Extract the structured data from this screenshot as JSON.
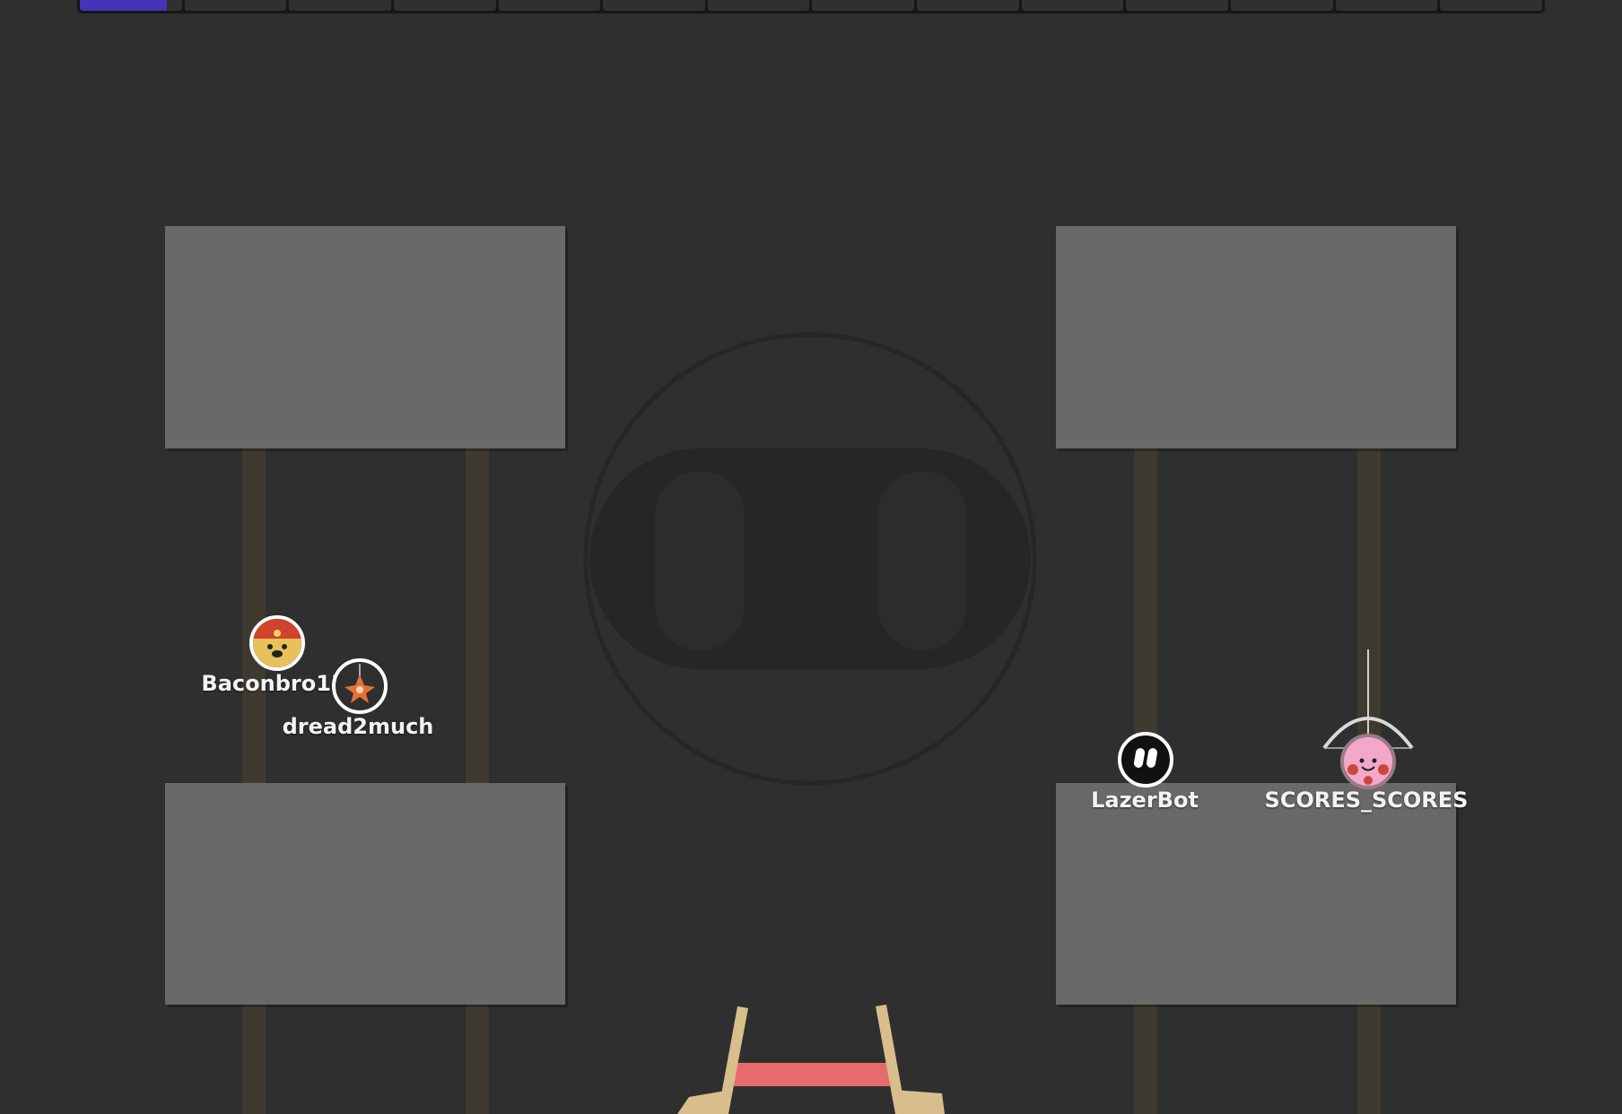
{
  "hud": {
    "progress_segments": 14,
    "progress_filled_fraction": 0.85,
    "accent_color": "#4634b8"
  },
  "map": {
    "background_color": "#2f2f2f",
    "platform_color": "#696969",
    "pillar_color": "#3f3a2f",
    "emblem": "bonk-logo-icon",
    "bottom_launcher_color": "#e86b6b"
  },
  "players": [
    {
      "name": "Baconbro15",
      "skin": "red-hat-face-icon"
    },
    {
      "name": "dread2much",
      "skin": "orange-star-icon"
    },
    {
      "name": "LazerBot",
      "skin": "white-pills-icon"
    },
    {
      "name": "SCORES_SCORES",
      "skin": "pink-face-icon",
      "weapon": "bow-icon"
    }
  ]
}
